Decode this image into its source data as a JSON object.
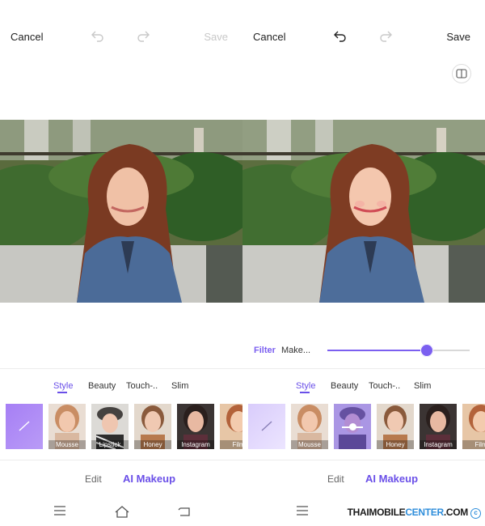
{
  "left_panel": {
    "cancel": "Cancel",
    "save": "Save",
    "tabs": [
      "Style",
      "Beauty",
      "Touch-..",
      "Slim"
    ],
    "active_tab": "Style",
    "thumbnails": [
      "",
      "Mousse",
      "Lipstick",
      "Honey",
      "Instagram",
      "Film"
    ],
    "mode_edit": "Edit",
    "mode_ai": "AI Makeup"
  },
  "right_panel": {
    "cancel": "Cancel",
    "save": "Save",
    "filter_label": "Filter",
    "makeup_label": "Make...",
    "slider_value": 0.7,
    "tabs": [
      "Style",
      "Beauty",
      "Touch-..",
      "Slim"
    ],
    "active_tab": "Style",
    "thumbnails": [
      "",
      "Mousse",
      "",
      "Honey",
      "Instagram",
      "Film"
    ],
    "mode_edit": "Edit",
    "mode_ai": "AI Makeup"
  },
  "watermark": {
    "prefix": "THAIMOBILE",
    "accent": "CENTER",
    "suffix": ".COM",
    "symbol": "c"
  },
  "colors": {
    "accent": "#6a4fe8",
    "slider": "#7b5ff0"
  },
  "icons": [
    "undo-icon",
    "redo-icon",
    "compare-icon",
    "menu-icon",
    "home-icon",
    "back-icon",
    "none-filter-icon",
    "copyright-icon"
  ]
}
